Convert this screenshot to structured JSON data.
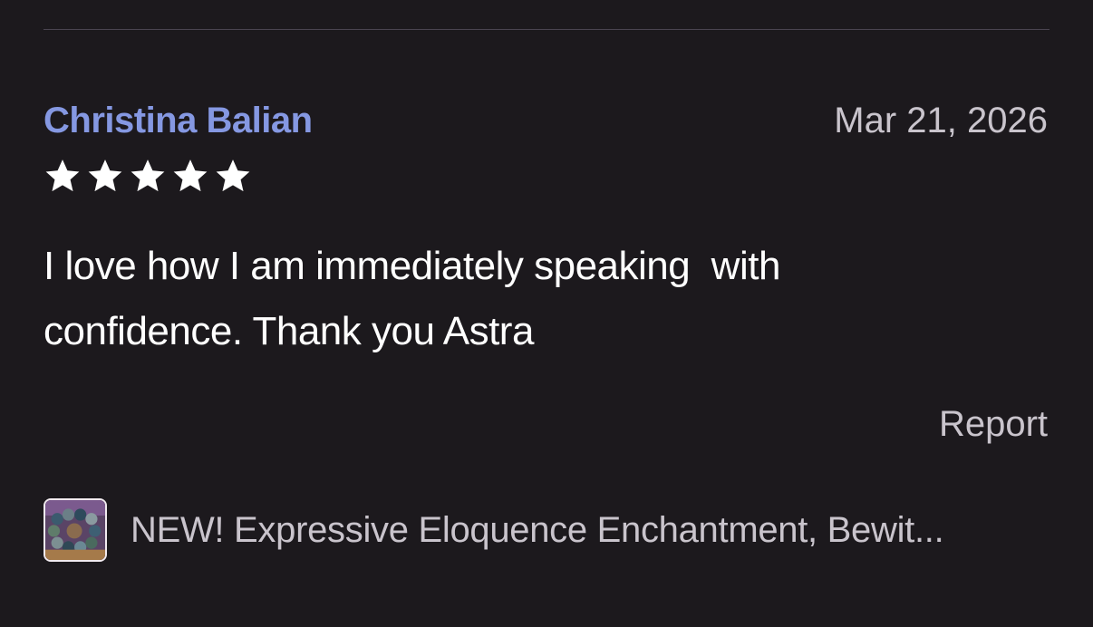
{
  "review": {
    "reviewer_name": "Christina Balian",
    "date": "Mar 21, 2026",
    "rating": 5,
    "rating_max": 5,
    "text": "I love how I am immediately speaking  with\nconfidence. Thank you Astra",
    "report_label": "Report"
  },
  "product": {
    "thumbnail_icon": "product-thumbnail",
    "title": "NEW! Expressive Eloquence Enchantment, Bewit..."
  },
  "colors": {
    "background": "#1c191d",
    "reviewer_name": "#8598e2",
    "secondary_text": "#c9c4cc",
    "primary_text": "#ffffff",
    "star": "#ffffff"
  }
}
